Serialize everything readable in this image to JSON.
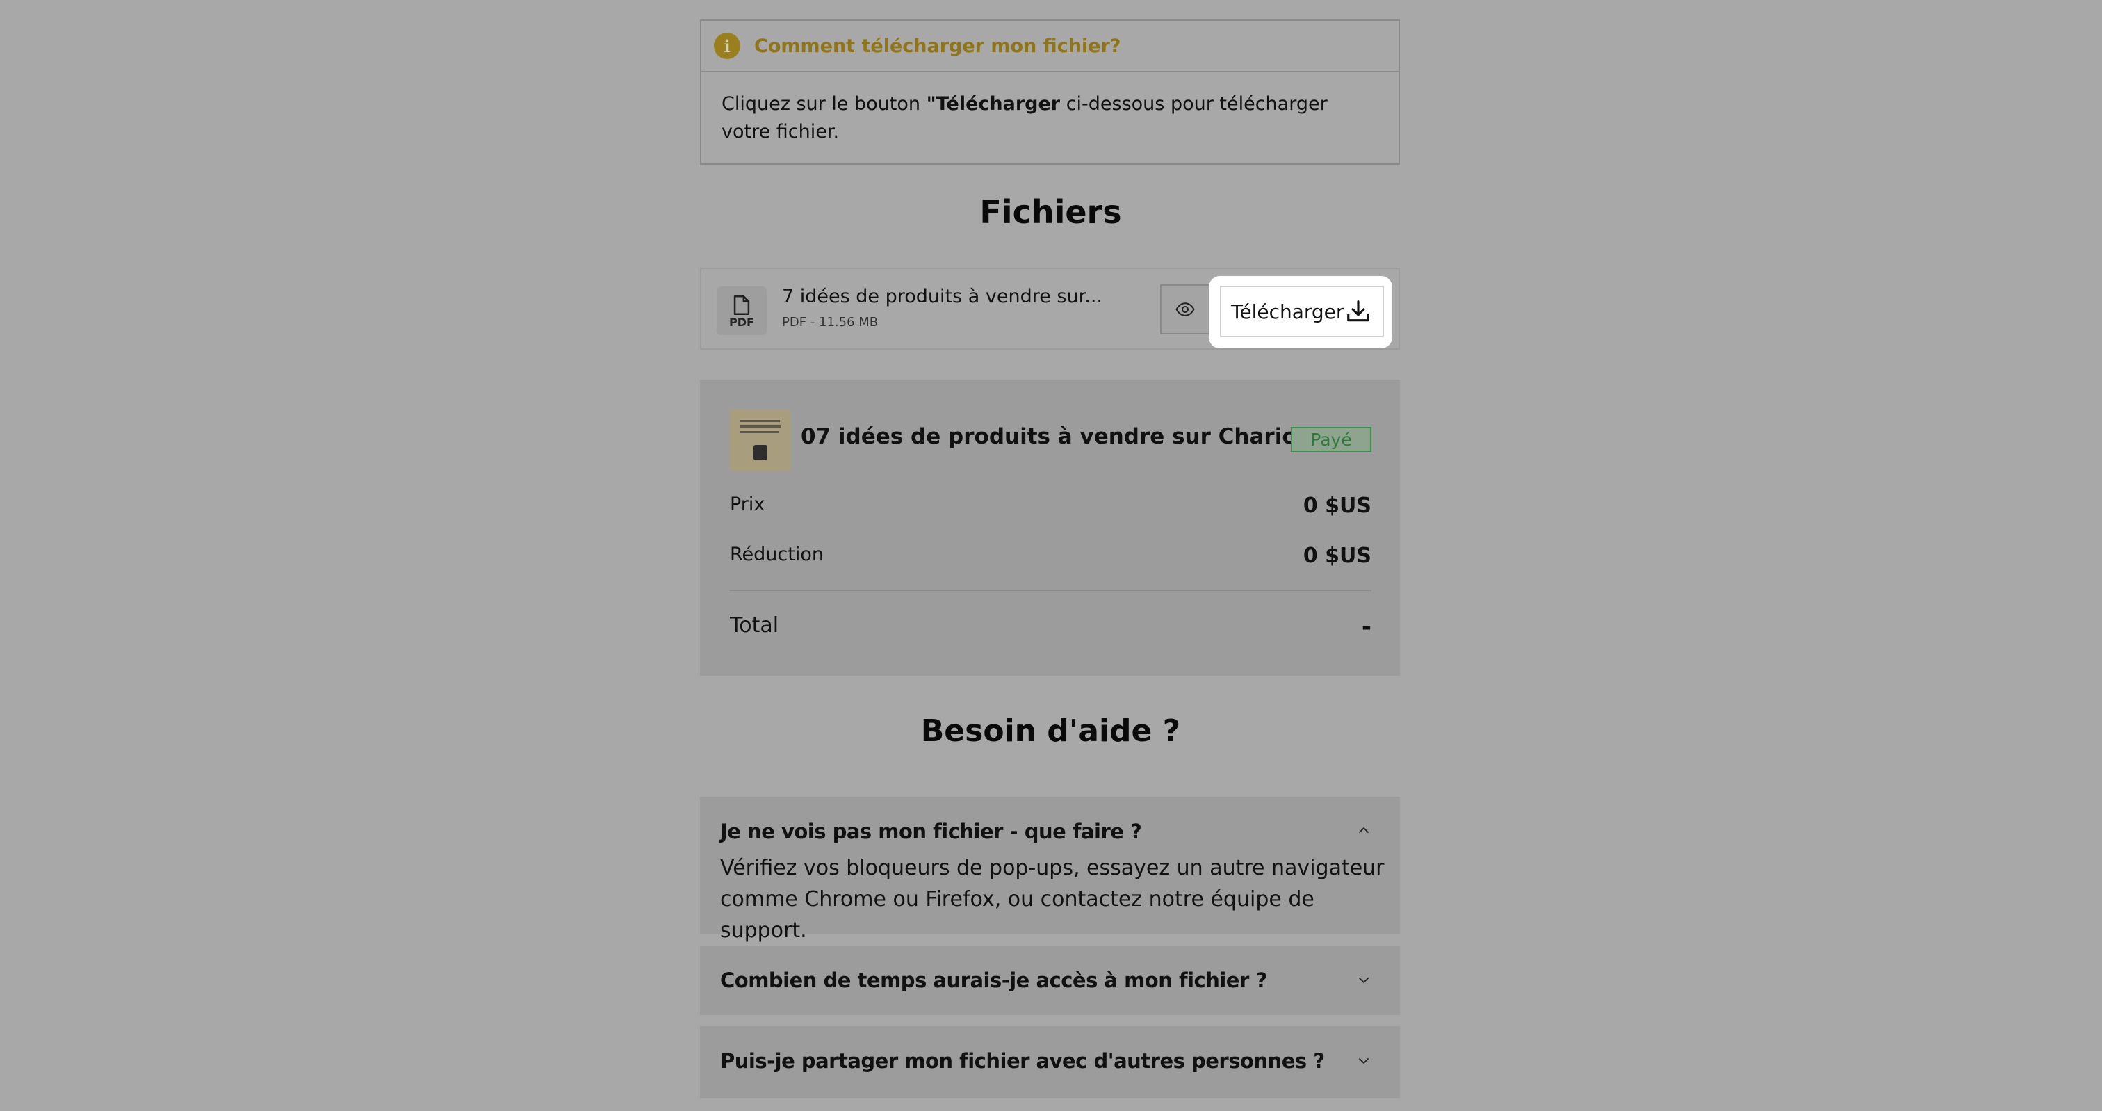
{
  "info": {
    "icon": "info-icon",
    "title": "Comment télécharger mon fichier?",
    "body_prefix": "Cliquez sur le bouton ",
    "body_bold": "\"Télécharger",
    "body_suffix": " ci-dessous pour télécharger votre fichier."
  },
  "files_heading": "Fichiers",
  "file": {
    "icon": "pdf-file-icon",
    "type_label": "PDF",
    "name": "7 idées de produits à vendre sur...",
    "meta": "PDF - 11.56 MB",
    "preview_icon": "eye-icon",
    "download_label": "Télécharger",
    "download_icon": "download-icon"
  },
  "summary": {
    "product_title": "07 idées de produits à vendre sur Chariow",
    "status": "Payé",
    "price_label": "Prix",
    "price_value": "0 $US",
    "discount_label": "Réduction",
    "discount_value": "0 $US",
    "total_label": "Total",
    "total_value": "-"
  },
  "help_heading": "Besoin d'aide ?",
  "faq": [
    {
      "question": "Je ne vois pas mon fichier - que faire ?",
      "answer": "Vérifiez vos bloqueurs de pop-ups, essayez un autre navigateur comme Chrome ou Firefox, ou contactez notre équipe de support.",
      "expanded": true,
      "icon": "chevron-up-icon"
    },
    {
      "question": "Combien de temps aurais-je accès à mon fichier ?",
      "expanded": false,
      "icon": "chevron-down-icon"
    },
    {
      "question": "Puis-je partager mon fichier avec d'autres personnes ?",
      "expanded": false,
      "icon": "chevron-down-icon"
    }
  ],
  "colors": {
    "overlay": "#a8a8a8",
    "accent": "#8f7418",
    "paid_green": "#2f7a3c"
  }
}
